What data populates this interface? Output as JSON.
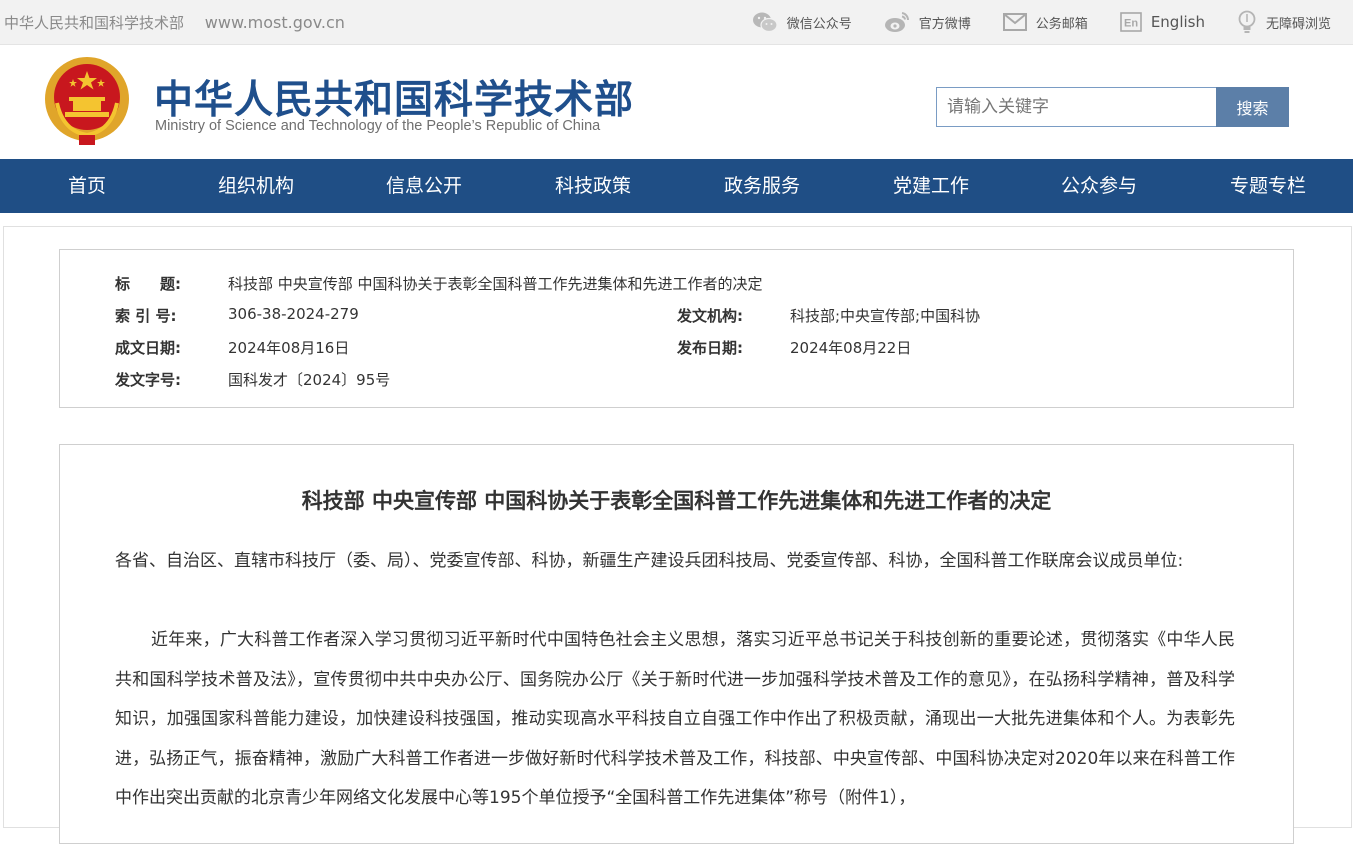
{
  "topbar": {
    "ministry_name": "中华人民共和国科学技术部",
    "url": "www.most.gov.cn",
    "links": [
      {
        "label": "微信公众号",
        "icon": "wechat-icon"
      },
      {
        "label": "官方微博",
        "icon": "weibo-icon"
      },
      {
        "label": "公务邮箱",
        "icon": "mail-icon"
      },
      {
        "label": "English",
        "icon": "en-icon"
      },
      {
        "label": "无障碍浏览",
        "icon": "accessibility-icon"
      }
    ]
  },
  "header": {
    "title": "中华人民共和国科学技术部",
    "subtitle": "Ministry of Science and Technology of the People’s Republic of China",
    "search_placeholder": "请输入关键字",
    "search_button": "搜索"
  },
  "nav": {
    "items": [
      "首页",
      "组织机构",
      "信息公开",
      "科技政策",
      "政务服务",
      "党建工作",
      "公众参与",
      "专题专栏"
    ]
  },
  "meta": {
    "title_label": "标　　题:",
    "title_value": "科技部 中央宣传部 中国科协关于表彰全国科普工作先进集体和先进工作者的决定",
    "index_label": "索 引 号:",
    "index_value": "306-38-2024-279",
    "org_label": "发文机构:",
    "org_value": "科技部;中央宣传部;中国科协",
    "created_label": "成文日期:",
    "created_value": "2024年08月16日",
    "published_label": "发布日期:",
    "published_value": "2024年08月22日",
    "docno_label": "发文字号:",
    "docno_value": "国科发才〔2024〕95号"
  },
  "document": {
    "title": "科技部 中央宣传部 中国科协关于表彰全国科普工作先进集体和先进工作者的决定",
    "salutation": "各省、自治区、直辖市科技厅（委、局）、党委宣传部、科协，新疆生产建设兵团科技局、党委宣传部、科协，全国科普工作联席会议成员单位:",
    "paragraph1": "近年来，广大科普工作者深入学习贯彻习近平新时代中国特色社会主义思想，落实习近平总书记关于科技创新的重要论述，贯彻落实《中华人民共和国科学技术普及法》，宣传贯彻中共中央办公厅、国务院办公厅《关于新时代进一步加强科学技术普及工作的意见》，在弘扬科学精神，普及科学知识，加强国家科普能力建设，加快建设科技强国，推动实现高水平科技自立自强工作中作出了积极贡献，涌现出一大批先进集体和个人。为表彰先进，弘扬正气，振奋精神，激励广大科普工作者进一步做好新时代科学技术普及工作，科技部、中央宣传部、中国科协决定对2020年以来在科普工作中作出突出贡献的北京青少年网络文化发展中心等195个单位授予“全国科普工作先进集体”称号（附件1），"
  },
  "colors": {
    "nav_bg": "#1f4e85",
    "title_blue": "#1f4f8c",
    "search_btn": "#5c7fa8"
  }
}
